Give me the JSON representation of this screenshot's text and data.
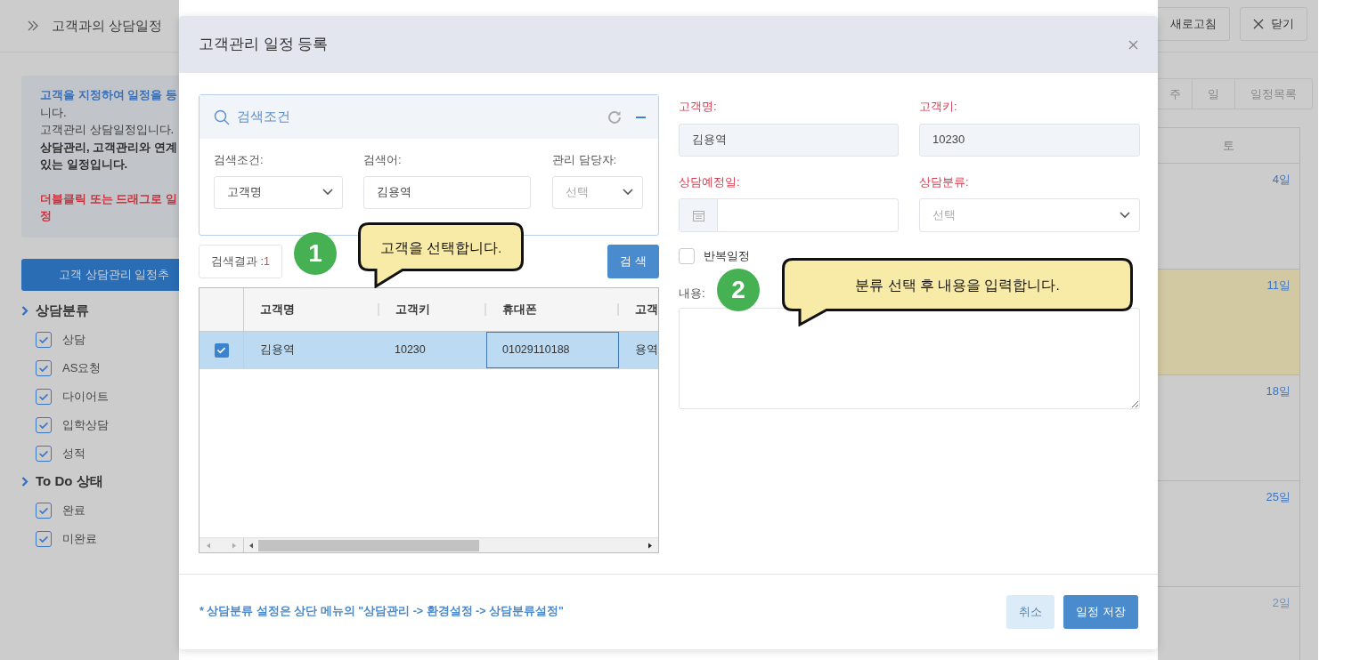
{
  "page": {
    "title": "고객과의 상담일정",
    "toolbar_buttons": [
      {
        "label": "새로고침",
        "kind": "refresh"
      },
      {
        "label": "닫기",
        "kind": "close"
      }
    ]
  },
  "sidebar": {
    "info_lines": [
      {
        "text": "고객을 지정하여 일정을 등",
        "kind": "link"
      },
      {
        "text": "니다.",
        "kind": "plain"
      },
      {
        "text": "고객관리 상담일정입니다.",
        "kind": "plain"
      },
      {
        "text": "상담관리, 고객관리와 연계",
        "kind": "bold"
      },
      {
        "text": "있는 일정입니다.",
        "kind": "bold"
      },
      {
        "text": "더블클릭 또는 드래그로 일",
        "kind": "alert"
      },
      {
        "text": "정",
        "kind": "alert"
      }
    ],
    "add_button": "고객 상담관리 일정추",
    "filter_groups": [
      {
        "title": "상담분류",
        "items": [
          {
            "label": "상담",
            "checked": true
          },
          {
            "label": "AS요청",
            "checked": true
          },
          {
            "label": "다이어트",
            "checked": true
          },
          {
            "label": "입학상담",
            "checked": true
          },
          {
            "label": "성적",
            "checked": true
          }
        ]
      },
      {
        "title": "To Do 상태",
        "items": [
          {
            "label": "완료",
            "checked": true
          },
          {
            "label": "미완료",
            "checked": true
          }
        ]
      }
    ]
  },
  "calendar": {
    "view_buttons": [
      {
        "label": "주",
        "selected": false
      },
      {
        "label": "일",
        "selected": false
      },
      {
        "label": "일정목록",
        "selected": false
      }
    ],
    "column_header": "토",
    "days": [
      {
        "label": "4일",
        "today": false,
        "other_month": false
      },
      {
        "label": "11일",
        "today": true,
        "other_month": false
      },
      {
        "label": "18일",
        "today": false,
        "other_month": false
      },
      {
        "label": "25일",
        "today": false,
        "other_month": false
      },
      {
        "label": "2일",
        "today": false,
        "other_month": true
      }
    ]
  },
  "modal": {
    "title": "고객관리 일정 등록",
    "search_panel": {
      "title": "검색조건",
      "fields": [
        {
          "label": "검색조건:",
          "kind": "select",
          "value": "고객명"
        },
        {
          "label": "검색어:",
          "kind": "text",
          "value": "김용역"
        },
        {
          "label": "관리 담당자:",
          "kind": "select",
          "placeholder": "선택"
        }
      ]
    },
    "result_label": "검색결과 : ",
    "result_count": "1",
    "search_button": "검 색",
    "grid": {
      "columns": [
        "고객명",
        "고객키",
        "휴대폰",
        "고객"
      ],
      "rows": [
        {
          "selected": true,
          "checked": true,
          "cells": [
            "김용역",
            "10230",
            "01029110188",
            "용역"
          ]
        }
      ]
    },
    "form": {
      "customer_name": {
        "label": "고객명:",
        "value": "김용역"
      },
      "customer_key": {
        "label": "고객키:",
        "value": "10230"
      },
      "date": {
        "label": "상담예정일:"
      },
      "category": {
        "label": "상담분류:",
        "placeholder": "선택"
      },
      "repeat": {
        "label": "반복일정",
        "checked": false
      },
      "content": {
        "label": "내용:"
      }
    },
    "footer_note": "* 상담분류 설정은 상단 메뉴의 \"상담관리 -> 환경설정 -> 상담분류설정\"",
    "buttons": [
      {
        "label": "취소",
        "kind": "secondary"
      },
      {
        "label": "일정 저장",
        "kind": "primary"
      }
    ]
  },
  "annotations": [
    {
      "number": "1",
      "text": "고객을 선택합니다."
    },
    {
      "number": "2",
      "text": "분류 선택 후 내용을 입력합니다."
    }
  ]
}
